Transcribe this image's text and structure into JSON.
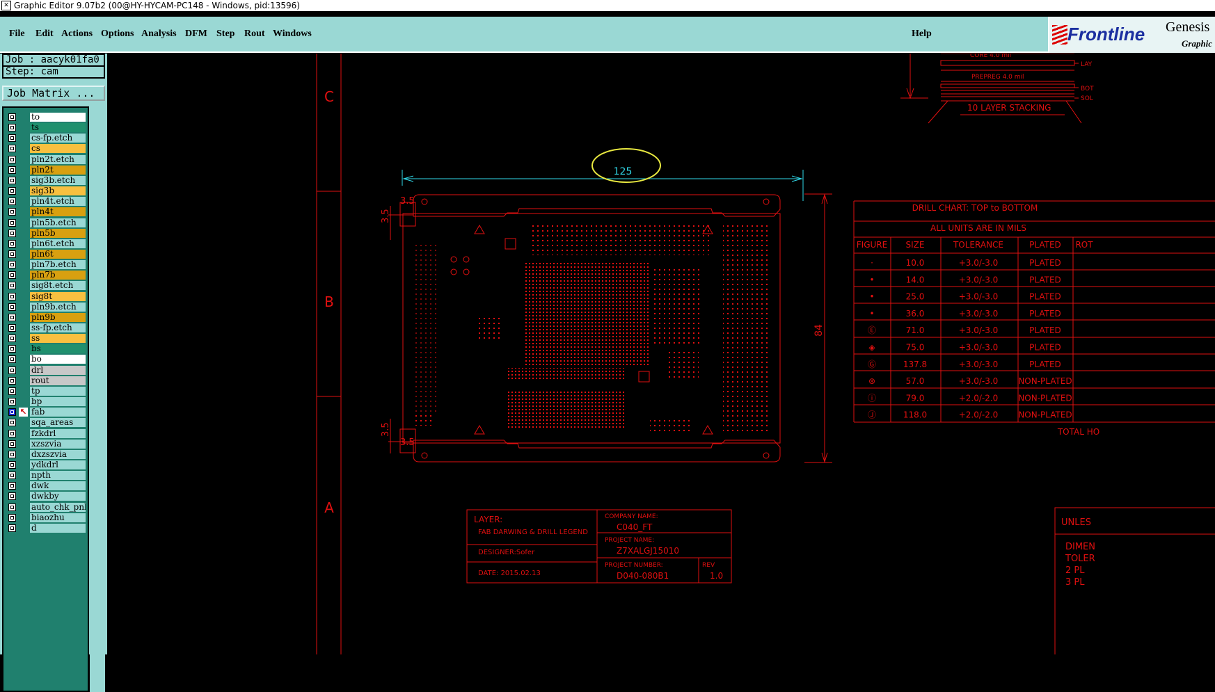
{
  "window": {
    "title": "Graphic Editor 9.07b2 (00@HY-HYCAM-PC148 - Windows, pid:13596)"
  },
  "menu": {
    "items": [
      "File",
      "Edit",
      "Actions",
      "Options",
      "Analysis",
      "DFM",
      "Step",
      "Rout",
      "Windows"
    ],
    "help": "Help"
  },
  "logo": {
    "brand": "Frontline",
    "product": "Genesis",
    "subtitle": "Graphic"
  },
  "job": {
    "job_label": "Job : aacyk01fa0",
    "step_label": "Step: cam",
    "matrix_button": "Job Matrix ..."
  },
  "layers": [
    {
      "name": "to",
      "color": "#ffffff"
    },
    {
      "name": "ts",
      "color": "#20906e"
    },
    {
      "name": "cs-fp.etch",
      "color": "#9ad8d4"
    },
    {
      "name": "cs",
      "color": "#f8c040"
    },
    {
      "name": "pln2t.etch",
      "color": "#9ad8d4"
    },
    {
      "name": "pln2t",
      "color": "#d8a010"
    },
    {
      "name": "sig3b.etch",
      "color": "#9ad8d4"
    },
    {
      "name": "sig3b",
      "color": "#f8c040"
    },
    {
      "name": "pln4t.etch",
      "color": "#9ad8d4"
    },
    {
      "name": "pln4t",
      "color": "#d8a010"
    },
    {
      "name": "pln5b.etch",
      "color": "#9ad8d4"
    },
    {
      "name": "pln5b",
      "color": "#d8a010"
    },
    {
      "name": "pln6t.etch",
      "color": "#9ad8d4"
    },
    {
      "name": "pln6t",
      "color": "#d8a010"
    },
    {
      "name": "pln7b.etch",
      "color": "#9ad8d4"
    },
    {
      "name": "pln7b",
      "color": "#d8a010"
    },
    {
      "name": "sig8t.etch",
      "color": "#9ad8d4"
    },
    {
      "name": "sig8t",
      "color": "#f8c040"
    },
    {
      "name": "pln9b.etch",
      "color": "#9ad8d4"
    },
    {
      "name": "pln9b",
      "color": "#d8a010"
    },
    {
      "name": "ss-fp.etch",
      "color": "#9ad8d4"
    },
    {
      "name": "ss",
      "color": "#f8c040"
    },
    {
      "name": "bs",
      "color": "#20906e"
    },
    {
      "name": "bo",
      "color": "#ffffff"
    },
    {
      "name": "drl",
      "color": "#c8c8c8"
    },
    {
      "name": "rout",
      "color": "#c8c8c8"
    },
    {
      "name": "tp",
      "color": "#9ad8d4"
    },
    {
      "name": "bp",
      "color": "#9ad8d4"
    },
    {
      "name": "fab",
      "color": "#9ad8d4",
      "selected": true
    },
    {
      "name": "sqa_areas",
      "color": "#9ad8d4"
    },
    {
      "name": "fzkdrl",
      "color": "#9ad8d4"
    },
    {
      "name": "xzszvia",
      "color": "#9ad8d4"
    },
    {
      "name": "dxzszvia",
      "color": "#9ad8d4"
    },
    {
      "name": "ydkdrl",
      "color": "#9ad8d4"
    },
    {
      "name": "npth",
      "color": "#9ad8d4"
    },
    {
      "name": "dwk",
      "color": "#9ad8d4"
    },
    {
      "name": "dwkby",
      "color": "#9ad8d4"
    },
    {
      "name": "auto_chk_pnl",
      "color": "#9ad8d4"
    },
    {
      "name": "biaozhu",
      "color": "#9ad8d4"
    },
    {
      "name": "d",
      "color": "#9ad8d4"
    }
  ],
  "drawing": {
    "zones": [
      "C",
      "B",
      "A"
    ],
    "stack": {
      "core": "CORE    4.0 mil",
      "prepreg": "PREPREG  4.0 mil",
      "title": "10 LAYER STACKING",
      "side_labels": [
        "LAY",
        "BOT",
        "SOL"
      ]
    },
    "dimensions": {
      "width": "125",
      "height": "84",
      "offsets": [
        "3.5",
        "3.5",
        "3.5",
        "3.5"
      ]
    },
    "drill_chart": {
      "title": "DRILL CHART: TOP to BOTTOM",
      "units": "ALL UNITS ARE IN MILS",
      "headers": [
        "FIGURE",
        "SIZE",
        "TOLERANCE",
        "PLATED",
        "ROT"
      ],
      "rows": [
        {
          "figure": "·",
          "size": "10.0",
          "tol": "+3.0/-3.0",
          "plated": "PLATED"
        },
        {
          "figure": "•",
          "size": "14.0",
          "tol": "+3.0/-3.0",
          "plated": "PLATED"
        },
        {
          "figure": "•",
          "size": "25.0",
          "tol": "+3.0/-3.0",
          "plated": "PLATED"
        },
        {
          "figure": "•",
          "size": "36.0",
          "tol": "+3.0/-3.0",
          "plated": "PLATED"
        },
        {
          "figure": "Ⓔ",
          "size": "71.0",
          "tol": "+3.0/-3.0",
          "plated": "PLATED"
        },
        {
          "figure": "◈",
          "size": "75.0",
          "tol": "+3.0/-3.0",
          "plated": "PLATED"
        },
        {
          "figure": "Ⓖ",
          "size": "137.8",
          "tol": "+3.0/-3.0",
          "plated": "PLATED"
        },
        {
          "figure": "⊛",
          "size": "57.0",
          "tol": "+3.0/-3.0",
          "plated": "NON-PLATED"
        },
        {
          "figure": "ⓘ",
          "size": "79.0",
          "tol": "+2.0/-2.0",
          "plated": "NON-PLATED"
        },
        {
          "figure": "Ⓙ",
          "size": "118.0",
          "tol": "+2.0/-2.0",
          "plated": "NON-PLATED"
        }
      ],
      "total": "TOTAL HO"
    },
    "title_block": {
      "layer_label": "LAYER:",
      "layer_value": "FAB DARWING & DRILL LEGEND",
      "designer": "DESIGNER:Sofer",
      "date": "DATE: 2015.02.13",
      "company_label": "COMPANY NAME:",
      "company_value": "C040_FT",
      "project_name_label": "PROJECT NAME:",
      "project_name_value": "Z7XALGJ15010",
      "project_number_label": "PROJECT NUMBER:",
      "project_number_value": "D040-080B1",
      "rev_label": "REV",
      "rev_value": "1.0"
    },
    "notes": {
      "title": "UNLES",
      "lines": [
        "DIMEN",
        "TOLER",
        "2 PL",
        "3 PL"
      ]
    }
  },
  "colors": {
    "cad_red": "#e01010",
    "cad_cyan": "#30d8e8",
    "highlight": "#e8e840",
    "panel": "#9ad8d4"
  }
}
